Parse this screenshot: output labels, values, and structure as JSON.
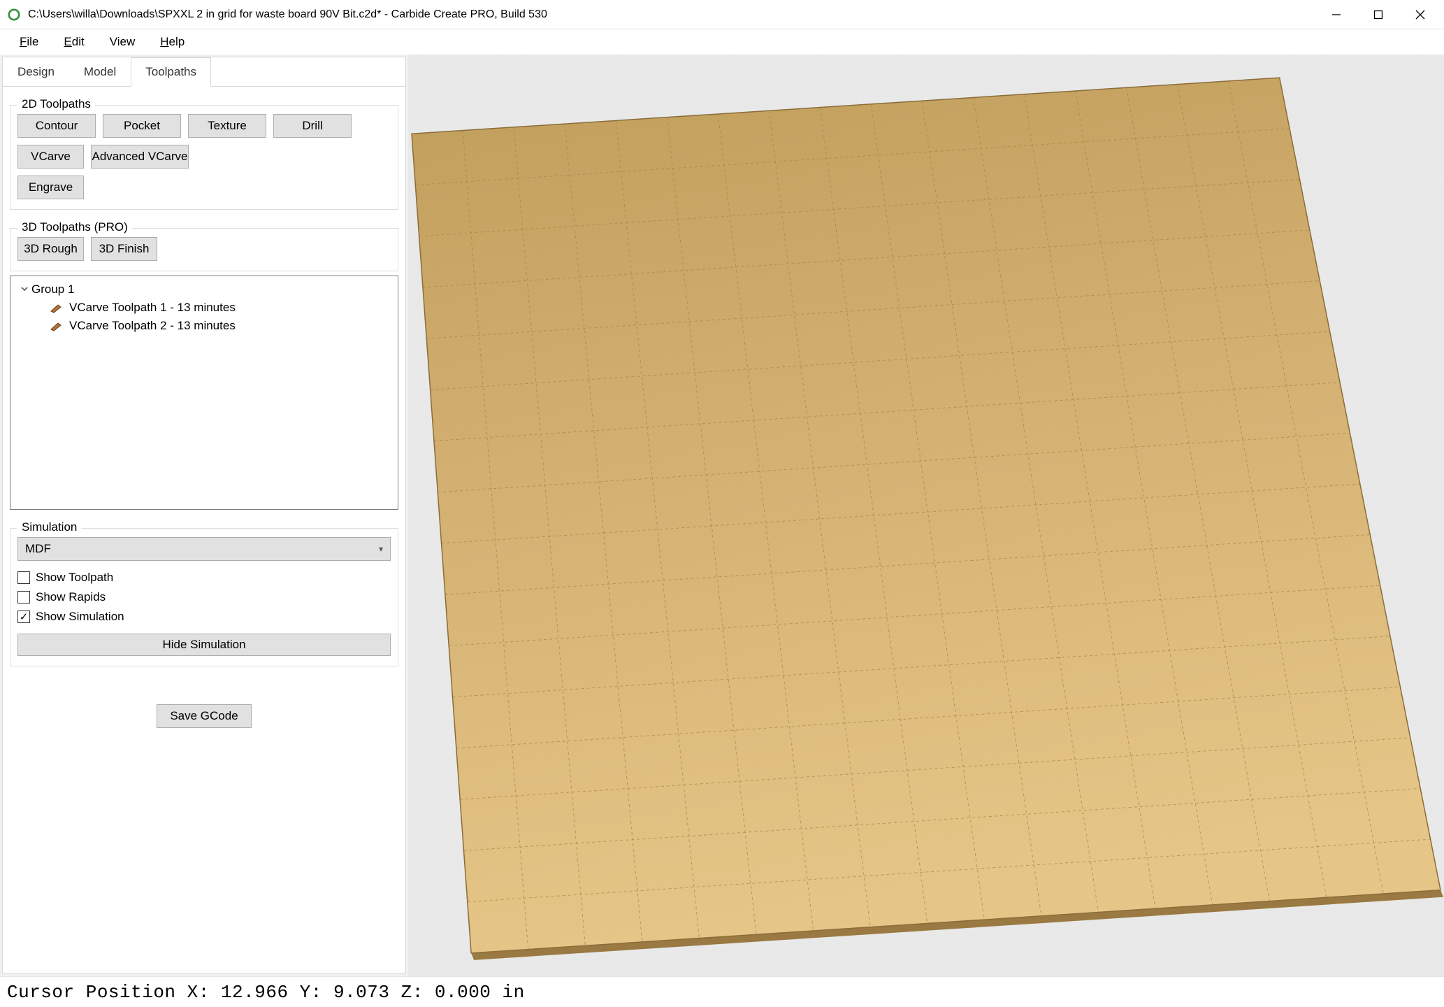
{
  "window": {
    "title": "C:\\Users\\willa\\Downloads\\SPXXL 2 in grid for waste board 90V Bit.c2d* - Carbide Create PRO, Build 530"
  },
  "menu": {
    "file": "File",
    "edit": "Edit",
    "view": "View",
    "help": "Help"
  },
  "tabs": {
    "design": "Design",
    "model": "Model",
    "toolpaths": "Toolpaths"
  },
  "toolpaths2d": {
    "legend": "2D Toolpaths",
    "contour": "Contour",
    "pocket": "Pocket",
    "texture": "Texture",
    "drill": "Drill",
    "vcarve": "VCarve",
    "adv_vcarve": "Advanced VCarve",
    "engrave": "Engrave"
  },
  "toolpaths3d": {
    "legend": "3D Toolpaths (PRO)",
    "rough": "3D Rough",
    "finish": "3D Finish"
  },
  "tree": {
    "group_label": "Group 1",
    "item1": "VCarve Toolpath 1 - 13 minutes",
    "item2": "VCarve Toolpath 2 - 13 minutes"
  },
  "simulation": {
    "legend": "Simulation",
    "material": "MDF",
    "show_toolpath": "Show Toolpath",
    "show_rapids": "Show Rapids",
    "show_simulation": "Show Simulation",
    "show_simulation_checked": true,
    "hide_simulation": "Hide Simulation"
  },
  "save_gcode": "Save GCode",
  "status": {
    "text": "Cursor Position X: 12.966 Y: 9.073 Z: 0.000 in"
  },
  "board": {
    "cols": 17,
    "rows": 16,
    "color_top": "#c7a763",
    "color_bottom": "#e4c383"
  }
}
